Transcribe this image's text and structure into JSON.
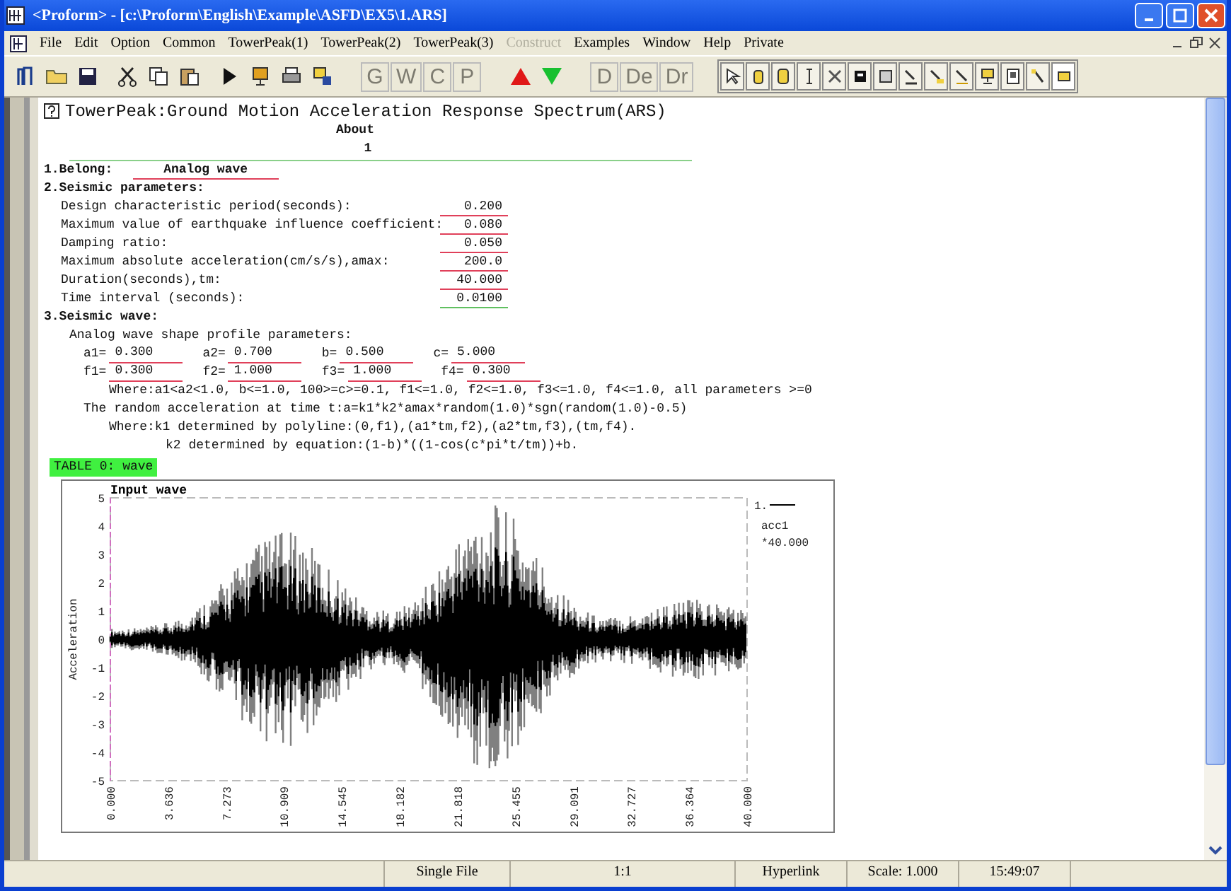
{
  "window": {
    "title": "<Proform> - [c:\\Proform\\English\\Example\\ASFD\\EX5\\1.ARS]"
  },
  "menu": [
    {
      "label": "File",
      "disabled": false
    },
    {
      "label": "Edit",
      "disabled": false
    },
    {
      "label": "Option",
      "disabled": false
    },
    {
      "label": "Common",
      "disabled": false
    },
    {
      "label": "TowerPeak(1)",
      "disabled": false
    },
    {
      "label": "TowerPeak(2)",
      "disabled": false
    },
    {
      "label": "TowerPeak(3)",
      "disabled": false
    },
    {
      "label": "Construct",
      "disabled": true
    },
    {
      "label": "Examples",
      "disabled": false
    },
    {
      "label": "Window",
      "disabled": false
    },
    {
      "label": "Help",
      "disabled": false
    },
    {
      "label": "Private",
      "disabled": false
    }
  ],
  "letter_buttons_1": [
    {
      "label": "G",
      "disabled": true
    },
    {
      "label": "W",
      "disabled": true
    },
    {
      "label": "C",
      "disabled": true
    },
    {
      "label": "P",
      "disabled": true
    }
  ],
  "letter_buttons_2": [
    {
      "label": "D",
      "disabled": true
    },
    {
      "label": "De",
      "disabled": true
    },
    {
      "label": "Dr",
      "disabled": true
    }
  ],
  "document": {
    "heading": "TowerPeak:Ground Motion Acceleration Response Spectrum(ARS)",
    "about": "About",
    "index": "1",
    "belong": {
      "label": "1.Belong:",
      "value": "Analog wave"
    },
    "section_2": "2.Seismic parameters:",
    "params": [
      {
        "label": "Design characteristic period(seconds):",
        "value": "0.200",
        "color": "#e0405a"
      },
      {
        "label": "Maximum value of earthquake influence coefficient:",
        "value": "0.080",
        "color": "#e0405a"
      },
      {
        "label": "Damping ratio:",
        "value": "0.050",
        "color": "#e0405a"
      },
      {
        "label": "Maximum absolute acceleration(cm/s/s),amax:",
        "value": "200.0",
        "color": "#e0405a"
      },
      {
        "label": "Duration(seconds),tm:",
        "value": "40.000",
        "color": "#e0405a"
      },
      {
        "label": "Time interval (seconds):",
        "value": "0.0100",
        "color": "#60c060"
      }
    ],
    "section_3": "3.Seismic wave:",
    "shape_heading": "Analog wave shape profile parameters:",
    "shape_rows": [
      [
        {
          "label": "a1=",
          "value": "0.300"
        },
        {
          "label": "a2=",
          "value": "0.700"
        },
        {
          "label": "b=",
          "value": "0.500"
        },
        {
          "label": "c=",
          "value": "5.000"
        }
      ],
      [
        {
          "label": "f1=",
          "value": "0.300"
        },
        {
          "label": "f2=",
          "value": "1.000"
        },
        {
          "label": "f3=",
          "value": "1.000"
        },
        {
          "label": "f4=",
          "value": "0.300"
        }
      ]
    ],
    "notes": [
      {
        "kind": "condition",
        "text": "Where:a1<a2<1.0,  b<=1.0,  100>=c>=0.1,   f1<=1.0,  f2<=1.0,  f3<=1.0,  f4<=1.0,  all parameters >=0"
      },
      {
        "kind": "formula",
        "text": "The random acceleration at time t:a=k1*k2*amax*random(1.0)*sgn(random(1.0)-0.5)"
      },
      {
        "kind": "condition",
        "text": "Where:k1 determined by polyline:(0,f1),(a1*tm,f2),(a2*tm,f3),(tm,f4)."
      },
      {
        "kind": "equation",
        "text": "k2 determined by equation:(1-b)*((1-cos(c*pi*t/tm))+b."
      }
    ],
    "table_label": "TABLE 0: wave",
    "chart": {
      "title": "Input wave",
      "ylabel": "Acceleration",
      "y_tick_labels": [
        "5",
        "4",
        "3",
        "2",
        "1",
        "0",
        "-1",
        "-2",
        "-3",
        "-4",
        "-5"
      ],
      "x_tick_labels": [
        "0.000",
        "3.636",
        "7.273",
        "10.909",
        "14.545",
        "18.182",
        "21.818",
        "25.455",
        "29.091",
        "32.727",
        "36.364",
        "40.000"
      ],
      "legend_index": "1.",
      "legend_name": "acc1",
      "legend_scale": "*40.000"
    }
  },
  "status_bar": {
    "file_mode": "Single File",
    "ratio": "1:1",
    "link": "Hyperlink",
    "scale": "Scale: 1.000",
    "time": "15:49:07"
  }
}
